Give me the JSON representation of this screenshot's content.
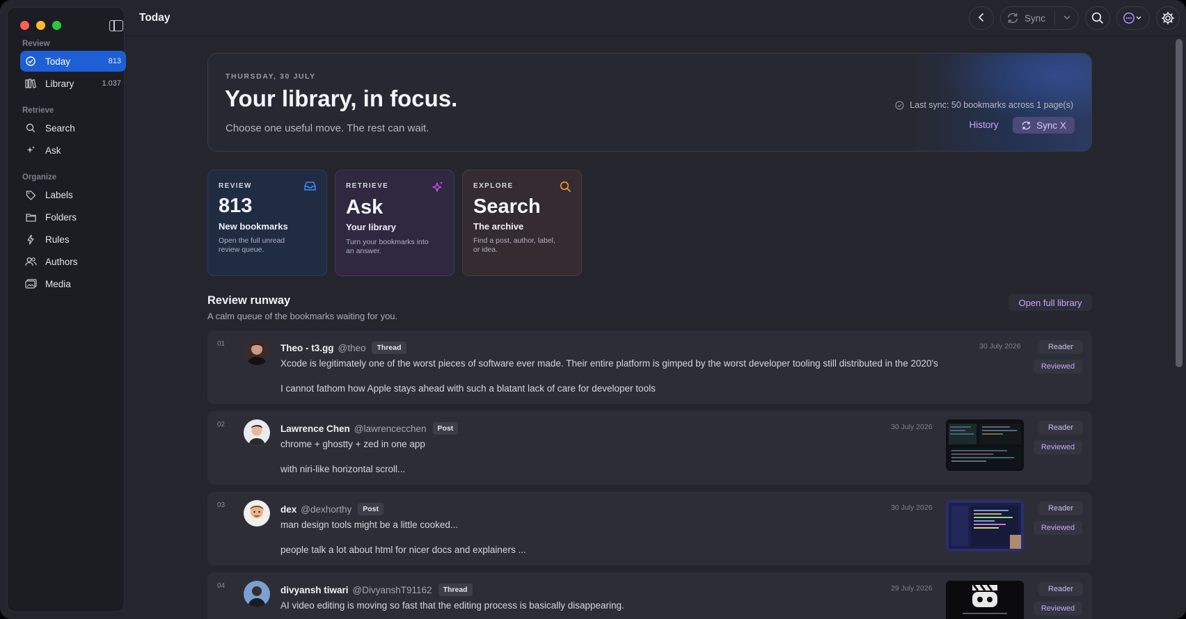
{
  "window": {
    "title": "Today"
  },
  "sidebar": {
    "sections": [
      {
        "label": "Review",
        "items": [
          {
            "label": "Today",
            "count": "813",
            "icon": "check-circle-icon",
            "active": true
          },
          {
            "label": "Library",
            "count": "1.037",
            "icon": "library-icon"
          }
        ]
      },
      {
        "label": "Retrieve",
        "items": [
          {
            "label": "Search",
            "icon": "search-icon"
          },
          {
            "label": "Ask",
            "icon": "sparkle-icon"
          }
        ]
      },
      {
        "label": "Organize",
        "items": [
          {
            "label": "Labels",
            "icon": "tag-icon"
          },
          {
            "label": "Folders",
            "icon": "folder-icon"
          },
          {
            "label": "Rules",
            "icon": "bolt-icon"
          },
          {
            "label": "Authors",
            "icon": "users-icon"
          },
          {
            "label": "Media",
            "icon": "media-icon"
          }
        ]
      }
    ]
  },
  "toolbar": {
    "sync_label": "Sync"
  },
  "hero": {
    "date": "THURSDAY, 30 JULY",
    "title": "Your library, in focus.",
    "subtitle": "Choose one useful move. The rest can wait.",
    "last_sync": "Last sync: 50 bookmarks across 1 page(s)",
    "history_label": "History",
    "sync_x_label": "Sync X"
  },
  "cards": [
    {
      "eyebrow": "REVIEW",
      "big": "813",
      "sub": "New bookmarks",
      "desc": "Open the full unread review queue.",
      "icon": "inbox-icon",
      "accent": "#3d8bff"
    },
    {
      "eyebrow": "RETRIEVE",
      "big": "Ask",
      "sub": "Your library",
      "desc": "Turn your bookmarks into an answer.",
      "icon": "sparkle-icon",
      "accent": "#d14df0"
    },
    {
      "eyebrow": "EXPLORE",
      "big": "Search",
      "sub": "The archive",
      "desc": "Find a post, author, label, or idea.",
      "icon": "search-icon",
      "accent": "#f29a3a"
    }
  ],
  "runway": {
    "title": "Review runway",
    "subtitle": "A calm queue of the bookmarks waiting for you.",
    "open_label": "Open full library",
    "items": [
      {
        "num": "01",
        "name": "Theo - t3.gg",
        "handle": "@theo",
        "type": "Thread",
        "date": "30 July 2026",
        "line1": "Xcode is legitimately one of the worst pieces of software ever made. Their entire platform is gimped by the worst developer tooling still distributed in the 2020's",
        "line2": "I cannot fathom how Apple stays ahead with such a blatant lack of care for developer tools",
        "reader": "Reader",
        "status": "Reviewed"
      },
      {
        "num": "02",
        "name": "Lawrence Chen",
        "handle": "@lawrencecchen",
        "type": "Post",
        "date": "30 July 2026",
        "line1": "chrome + ghostty + zed in one app",
        "line2": "with niri-like horizontal scroll...",
        "reader": "Reader",
        "status": "Reviewed"
      },
      {
        "num": "03",
        "name": "dex",
        "handle": "@dexhorthy",
        "type": "Post",
        "date": "30 July 2026",
        "line1": "man design tools might be a little cooked...",
        "line2": "people talk a lot about html for nicer docs and explainers ...",
        "reader": "Reader",
        "status": "Reviewed"
      },
      {
        "num": "04",
        "name": "divyansh tiwari",
        "handle": "@DivyanshT91162",
        "type": "Thread",
        "date": "29 July 2026",
        "line1": "AI video editing is moving so fast that the editing process is basically disappearing.",
        "line2": "",
        "reader": "Reader",
        "status": "Reviewed"
      }
    ]
  }
}
